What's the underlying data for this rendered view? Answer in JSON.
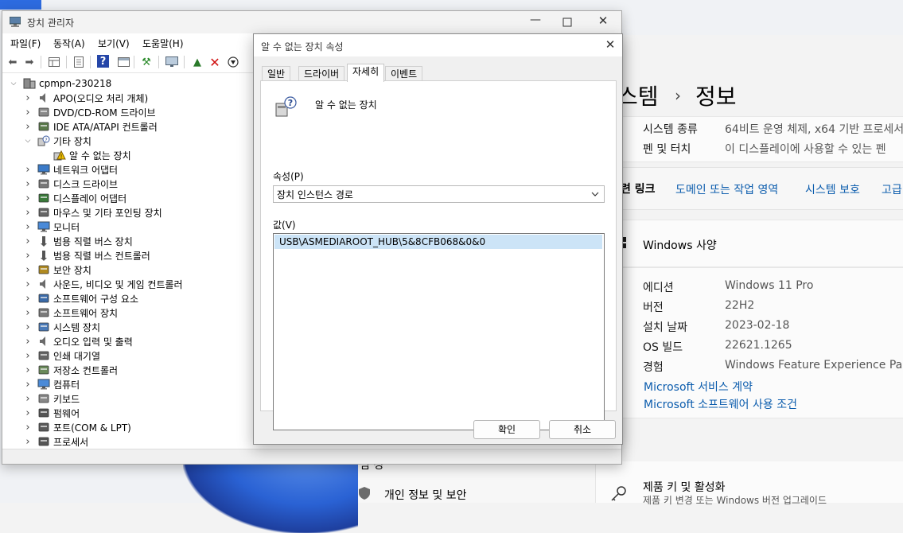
{
  "settings": {
    "heading_prefix": "스템",
    "heading_sep": "›",
    "heading_title": "정보",
    "rows_top": [
      {
        "key": "시스템 종류",
        "value": "64비트 운영 체제, x64 기반 프로세서"
      },
      {
        "key": "펜 및 터치",
        "value": "이 디스플레이에 사용할 수 있는 펜"
      }
    ],
    "related_label": "련 링크",
    "related_links": [
      "도메인 또는 작업 영역",
      "시스템 보호",
      "고급"
    ],
    "windows_spec_title": "Windows 사양",
    "spec_rows": [
      {
        "key": "에디션",
        "value": "Windows 11 Pro"
      },
      {
        "key": "버전",
        "value": "22H2"
      },
      {
        "key": "설치 날짜",
        "value": "2023-02-18"
      },
      {
        "key": "OS 빌드",
        "value": "22621.1265"
      },
      {
        "key": "경험",
        "value": "Windows Feature Experience Pack"
      }
    ],
    "spec_links": [
      "Microsoft 서비스 계약",
      "Microsoft 소프트웨어 사용 조건"
    ],
    "bottom_left_partial": "림 정",
    "bottom_left_item": "개인 정보 및 보안",
    "product_key_title": "제품 키 및 활성화",
    "product_key_sub": "제품 키 변경 또는 Windows 버전 업그레이드"
  },
  "devmgr": {
    "title": "장치 관리자",
    "menu": [
      "파일(F)",
      "동작(A)",
      "보기(V)",
      "도움말(H)"
    ],
    "root": "cpmpn-230218",
    "items": [
      {
        "label": "APO(오디오 처리 개체)",
        "icon": "speaker-icon",
        "state": "collapsed"
      },
      {
        "label": "DVD/CD-ROM 드라이브",
        "icon": "dvd-drive-icon",
        "state": "collapsed"
      },
      {
        "label": "IDE ATA/ATAPI 컨트롤러",
        "icon": "controller-icon",
        "state": "collapsed"
      },
      {
        "label": "기타 장치",
        "icon": "unknown-device-icon",
        "state": "expanded"
      },
      {
        "label": "알 수 없는 장치",
        "icon": "warning-device-icon",
        "state": "child"
      },
      {
        "label": "네트워크 어댑터",
        "icon": "network-icon",
        "state": "collapsed"
      },
      {
        "label": "디스크 드라이브",
        "icon": "disk-icon",
        "state": "collapsed"
      },
      {
        "label": "디스플레이 어댑터",
        "icon": "display-adapter-icon",
        "state": "collapsed"
      },
      {
        "label": "마우스 및 기타 포인팅 장치",
        "icon": "mouse-icon",
        "state": "collapsed"
      },
      {
        "label": "모니터",
        "icon": "monitor-icon",
        "state": "collapsed"
      },
      {
        "label": "범용 직렬 버스 장치",
        "icon": "usb-icon",
        "state": "collapsed"
      },
      {
        "label": "범용 직렬 버스 컨트롤러",
        "icon": "usb-icon",
        "state": "collapsed"
      },
      {
        "label": "보안 장치",
        "icon": "security-key-icon",
        "state": "collapsed"
      },
      {
        "label": "사운드, 비디오 및 게임 컨트롤러",
        "icon": "speaker-icon",
        "state": "collapsed"
      },
      {
        "label": "소프트웨어 구성 요소",
        "icon": "component-icon",
        "state": "collapsed"
      },
      {
        "label": "소프트웨어 장치",
        "icon": "software-device-icon",
        "state": "collapsed"
      },
      {
        "label": "시스템 장치",
        "icon": "system-folder-icon",
        "state": "collapsed"
      },
      {
        "label": "오디오 입력 및 출력",
        "icon": "speaker-icon",
        "state": "collapsed"
      },
      {
        "label": "인쇄 대기열",
        "icon": "printer-icon",
        "state": "collapsed"
      },
      {
        "label": "저장소 컨트롤러",
        "icon": "storage-controller-icon",
        "state": "collapsed"
      },
      {
        "label": "컴퓨터",
        "icon": "computer-icon",
        "state": "collapsed"
      },
      {
        "label": "키보드",
        "icon": "keyboard-icon",
        "state": "collapsed"
      },
      {
        "label": "펌웨어",
        "icon": "chip-icon",
        "state": "collapsed"
      },
      {
        "label": "포트(COM & LPT)",
        "icon": "port-icon",
        "state": "collapsed"
      },
      {
        "label": "프로세서",
        "icon": "chip-icon",
        "state": "collapsed"
      }
    ]
  },
  "dialog": {
    "title": "알 수 없는 장치 속성",
    "tabs": [
      "일반",
      "드라이버",
      "자세히",
      "이벤트"
    ],
    "active_tab": "자세히",
    "device_name": "알 수 없는 장치",
    "property_label": "속성(P)",
    "property_value": "장치 인스턴스 경로",
    "value_label": "값(V)",
    "value_item": "USB\\ASMEDIAROOT_HUB\\5&8CFB068&0&0",
    "ok_label": "확인",
    "cancel_label": "취소"
  }
}
